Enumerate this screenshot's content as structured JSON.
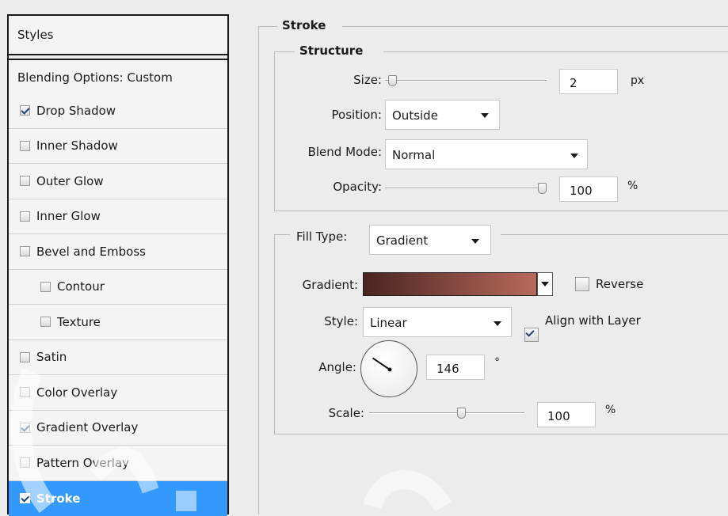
{
  "styles_panel": {
    "header": "Styles",
    "blending": "Blending Options: Custom",
    "effects": [
      {
        "label": "Drop Shadow",
        "checked": true,
        "sub": false,
        "selected": false
      },
      {
        "label": "Inner Shadow",
        "checked": false,
        "sub": false,
        "selected": false
      },
      {
        "label": "Outer Glow",
        "checked": false,
        "sub": false,
        "selected": false
      },
      {
        "label": "Inner Glow",
        "checked": false,
        "sub": false,
        "selected": false
      },
      {
        "label": "Bevel and Emboss",
        "checked": false,
        "sub": false,
        "selected": false
      },
      {
        "label": "Contour",
        "checked": false,
        "sub": true,
        "selected": false
      },
      {
        "label": "Texture",
        "checked": false,
        "sub": true,
        "selected": false
      },
      {
        "label": "Satin",
        "checked": false,
        "sub": false,
        "selected": false
      },
      {
        "label": "Color Overlay",
        "checked": false,
        "sub": false,
        "selected": false
      },
      {
        "label": "Gradient Overlay",
        "checked": true,
        "sub": false,
        "selected": false
      },
      {
        "label": "Pattern Overlay",
        "checked": false,
        "sub": false,
        "selected": false
      },
      {
        "label": "Stroke",
        "checked": true,
        "sub": false,
        "selected": true
      }
    ]
  },
  "stroke": {
    "title": "Stroke",
    "structure_title": "Structure",
    "size": {
      "label": "Size:",
      "value": "2",
      "unit": "px",
      "slider_fraction": 0.02
    },
    "position": {
      "label": "Position:",
      "value": "Outside"
    },
    "blend_mode": {
      "label": "Blend Mode:",
      "value": "Normal"
    },
    "opacity": {
      "label": "Opacity:",
      "value": "100",
      "unit": "%",
      "slider_fraction": 1.0
    },
    "fill_type": {
      "label": "Fill Type:",
      "value": "Gradient"
    },
    "gradient": {
      "label": "Gradient:",
      "start_color": "#4a2420",
      "end_color": "#b86a5c"
    },
    "reverse": {
      "label": "Reverse",
      "checked": false
    },
    "style": {
      "label": "Style:",
      "value": "Linear"
    },
    "align_with_layer": {
      "label": "Align with Layer",
      "checked": true
    },
    "angle": {
      "label": "Angle:",
      "value": "146",
      "unit": "°",
      "degrees": 146
    },
    "scale": {
      "label": "Scale:",
      "value": "100",
      "unit": "%",
      "slider_fraction": 0.6
    }
  },
  "colors": {
    "selection": "#3399ff",
    "panel_bg": "#ececec"
  }
}
